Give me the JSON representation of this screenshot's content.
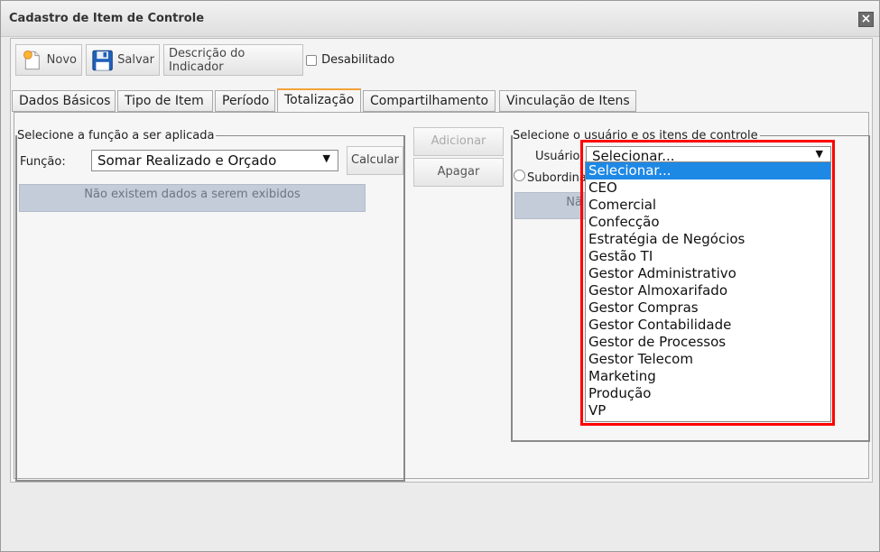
{
  "window": {
    "title": "Cadastro de Item de Controle",
    "close_glyph": "×"
  },
  "toolbar": {
    "novo_label": "Novo",
    "salvar_label": "Salvar",
    "descricao_label": "Descrição do Indicador",
    "desabilitado_label": "Desabilitado"
  },
  "tabs": [
    {
      "label": "Dados Básicos"
    },
    {
      "label": "Tipo de Item"
    },
    {
      "label": "Período"
    },
    {
      "label": "Totalização"
    },
    {
      "label": "Compartilhamento"
    },
    {
      "label": "Vinculação de Itens"
    }
  ],
  "left_panel": {
    "legend": "Selecione a função a ser aplicada",
    "funcao_label": "Função:",
    "funcao_value": "Somar Realizado e Orçado",
    "calcular_label": "Calcular",
    "empty_message": "Não existem dados a serem exibidos"
  },
  "middle": {
    "adicionar_label": "Adicionar",
    "apagar_label": "Apagar"
  },
  "right_panel": {
    "legend": "Selecione o usuário e os itens de controle",
    "usuario_label": "Usuário:",
    "usuario_value": "Selecionar...",
    "subordinados_label": "Subordina",
    "empty_message_partial": "Nã"
  },
  "dropdown": {
    "options": [
      "Selecionar...",
      "CEO",
      "Comercial",
      "Confecção",
      "Estratégia de Negócios",
      "Gestão TI",
      "Gestor Administrativo",
      "Gestor Almoxarifado",
      "Gestor Compras",
      "Gestor Contabilidade",
      "Gestor de Processos",
      "Gestor Telecom",
      "Marketing",
      "Produção",
      "VP"
    ],
    "selected_index": 0,
    "highlight_color": "#ff0000",
    "selected_color": "#1e88e5"
  },
  "colors": {
    "active_tab_accent": "#f0a23a"
  }
}
